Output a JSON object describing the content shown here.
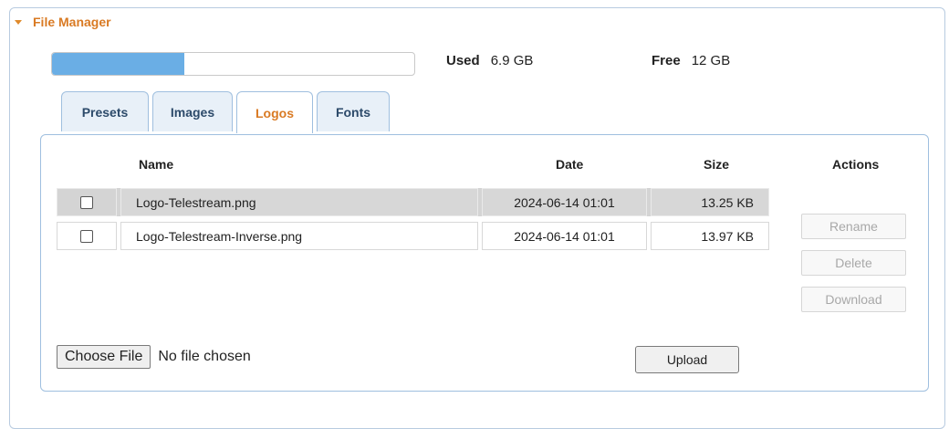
{
  "section": {
    "title": "File Manager"
  },
  "storage": {
    "used_label": "Used",
    "used_value": "6.9 GB",
    "free_label": "Free",
    "free_value": "12 GB",
    "used_fraction": 0.365,
    "bar_color": "#6aaee5"
  },
  "tabs": [
    {
      "label": "Presets",
      "active": false
    },
    {
      "label": "Images",
      "active": false
    },
    {
      "label": "Logos",
      "active": true
    },
    {
      "label": "Fonts",
      "active": false
    }
  ],
  "table": {
    "columns": {
      "name": "Name",
      "date": "Date",
      "size": "Size",
      "actions": "Actions"
    },
    "rows": [
      {
        "name": "Logo-Telestream.png",
        "date": "2024-06-14 01:01",
        "size": "13.25 KB",
        "checked": false,
        "highlighted": true
      },
      {
        "name": "Logo-Telestream-Inverse.png",
        "date": "2024-06-14 01:01",
        "size": "13.97 KB",
        "checked": false,
        "highlighted": false
      }
    ]
  },
  "actions": {
    "rename": "Rename",
    "delete": "Delete",
    "download": "Download"
  },
  "upload": {
    "choose_label": "Choose File",
    "status": "No file chosen",
    "upload_label": "Upload"
  },
  "colors": {
    "accent": "#d97a23",
    "tab_border": "#9fbfdf",
    "selected_row": "#d4d4d4"
  }
}
